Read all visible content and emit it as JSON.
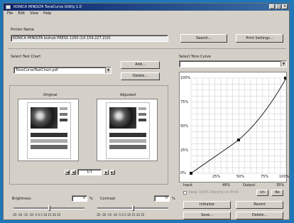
{
  "window": {
    "title": "KONICA MINOLTA ToneCurve Utility 1.0"
  },
  "menu": [
    "File",
    "Edit",
    "View",
    "Help"
  ],
  "printer": {
    "label": "Printer Name",
    "value": "KONICA MINOLTA bizhub PRESS 1250 (10.159.227.210)",
    "search_label": "Search...",
    "print_settings_label": "Print Settings..."
  },
  "test_chart": {
    "label": "Select Test Chart",
    "value": "ToneCurveTestChart.pdf",
    "add_label": "Add...",
    "delete_label": "Delete..."
  },
  "preview": {
    "original_label": "Original",
    "adjusted_label": "Adjusted",
    "page_indicator": "1/1"
  },
  "brightness": {
    "label": "Brightness",
    "value": "0",
    "unit": "%",
    "ticks": "-25 -20 -15 -10 -5  0  5  10  15  20  25"
  },
  "contrast": {
    "label": "Contrast",
    "value": "0",
    "unit": "%",
    "ticks": "-25 -20 -15 -10 -5  0  5  10  15  20  25"
  },
  "tone_curve": {
    "label": "Select Tone Curve",
    "y_ticks": [
      "100%",
      "75%",
      "50%",
      "25%",
      "0%"
    ],
    "x_ticks": [
      "25%",
      "50%",
      "75%",
      "100%"
    ],
    "input_label": "Input",
    "input_value": "49%",
    "output_label": "Output",
    "output_value": "35%",
    "keep_label": "Keep 100% Density on Print",
    "undo_label": "Un",
    "redo_label": "Re",
    "initialize_label": "Initialize",
    "revert_label": "Revert",
    "save_label": "Save...",
    "delete_label": "Delete..."
  }
}
